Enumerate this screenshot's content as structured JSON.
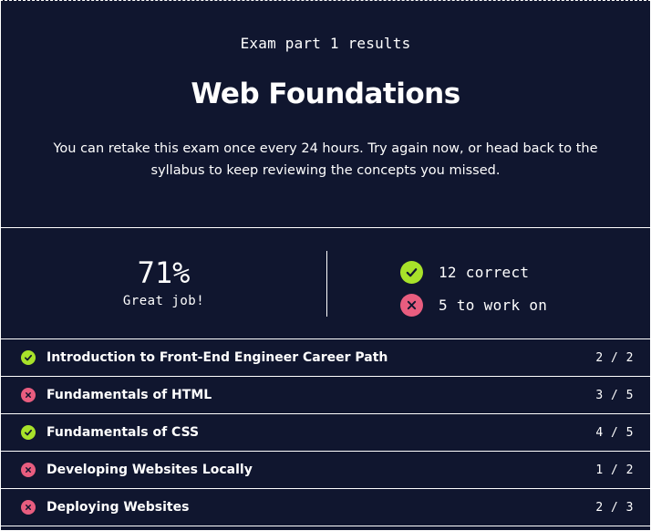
{
  "header": {
    "eyebrow": "Exam part 1 results",
    "title": "Web Foundations",
    "description": "You can retake this exam once every 24 hours. Try again now, or head back to the syllabus to keep reviewing the concepts you missed."
  },
  "score": {
    "percent": "71%",
    "verdict": "Great job!",
    "correct_label": "12 correct",
    "incorrect_label": "5 to work on"
  },
  "modules": [
    {
      "title": "Introduction to Front-End Engineer Career Path",
      "score": "2 / 2",
      "status": "passed",
      "icon": "check-circle-icon"
    },
    {
      "title": "Fundamentals of HTML",
      "score": "3 / 5",
      "status": "failed",
      "icon": "x-circle-icon"
    },
    {
      "title": "Fundamentals of CSS",
      "score": "4 / 5",
      "status": "passed",
      "icon": "check-circle-icon"
    },
    {
      "title": "Developing Websites Locally",
      "score": "1 / 2",
      "status": "failed",
      "icon": "x-circle-icon"
    },
    {
      "title": "Deploying Websites",
      "score": "2 / 3",
      "status": "failed",
      "icon": "x-circle-icon"
    }
  ],
  "colors": {
    "background": "#10162f",
    "success": "#a8e22a",
    "danger": "#e85d7f",
    "text": "#ffffff"
  }
}
